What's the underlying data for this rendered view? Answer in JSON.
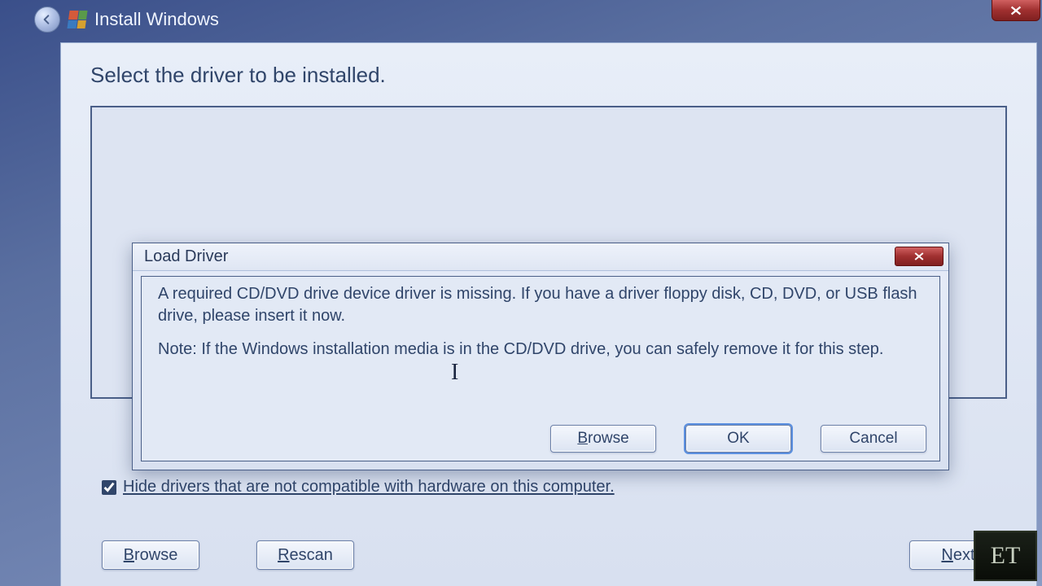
{
  "window": {
    "title": "Install Windows"
  },
  "panel": {
    "heading": "Select the driver to be installed.",
    "hide_checkbox_checked": true,
    "hide_label": "Hide drivers that are not compatible with hardware on this computer.",
    "browse_prefix": "B",
    "browse_suffix": "rowse",
    "rescan_prefix": "R",
    "rescan_suffix": "escan",
    "next_prefix": "N",
    "next_suffix": "ext"
  },
  "dialog": {
    "title": "Load Driver",
    "msg1": "A required CD/DVD drive device driver is missing. If you have a driver floppy disk, CD, DVD, or USB flash drive, please insert it now.",
    "msg2": "Note: If the Windows installation media is in the CD/DVD drive, you can safely remove it for this step.",
    "browse_prefix": "B",
    "browse_suffix": "rowse",
    "ok_label": "OK",
    "cancel_label": "Cancel"
  },
  "watermark": "ET"
}
